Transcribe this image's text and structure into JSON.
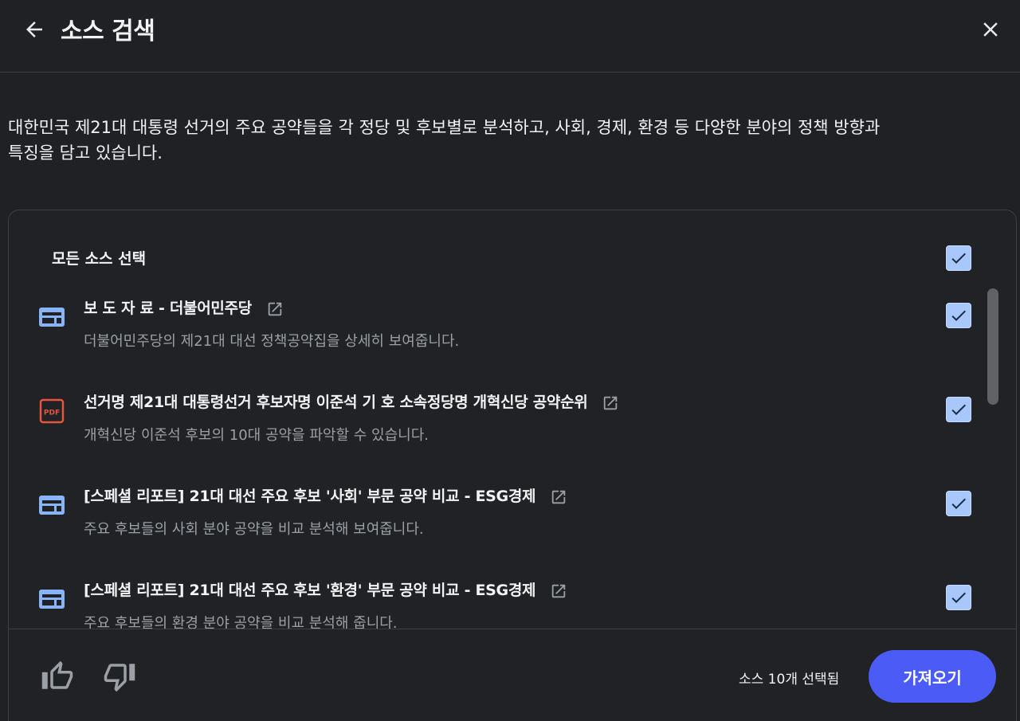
{
  "header": {
    "title": "소스 검색"
  },
  "description": {
    "line1": "대한민국 제21대 대통령 선거의 주요 공약들을 각 정당 및 후보별로 분석하고, 사회, 경제, 환경 등 다양한 분야의 정책 방향과",
    "line2": "특징을 담고 있습니다."
  },
  "select_all": {
    "label": "모든 소스 선택",
    "checked": true
  },
  "items": [
    {
      "type": "web-icon",
      "title": "보 도 자 료 - 더불어민주당",
      "description": "더불어민주당의 제21대 대선 정책공약집을 상세히 보여줍니다.",
      "checked": true
    },
    {
      "type": "pdf-icon",
      "title": "선거명 제21대 대통령선거 후보자명 이준석 기 호 소속정당명 개혁신당 공약순위",
      "description": "개혁신당 이준석 후보의 10대 공약을 파악할 수 있습니다.",
      "checked": true
    },
    {
      "type": "web-icon",
      "title": "[스페셜 리포트] 21대 대선 주요 후보 '사회' 부문 공약 비교 - ESG경제",
      "description": "주요 후보들의 사회 분야 공약을 비교 분석해 보여줍니다.",
      "checked": true
    },
    {
      "type": "web-icon",
      "title": "[스페셜 리포트] 21대 대선 주요 후보 '환경' 부문 공약 비교 - ESG경제",
      "description": "주요 후보들의 환경 분야 공약을 비교 분석해 줍니다.",
      "checked": true
    }
  ],
  "footer": {
    "selected_count": "소스 10개 선택됨",
    "import_label": "가져오기"
  },
  "colors": {
    "background": "#1f2125",
    "accent": "#4a5cf5",
    "checkbox": "#a8c7fa",
    "web_icon": "#8ab4f8",
    "pdf_icon": "#e8553e"
  }
}
